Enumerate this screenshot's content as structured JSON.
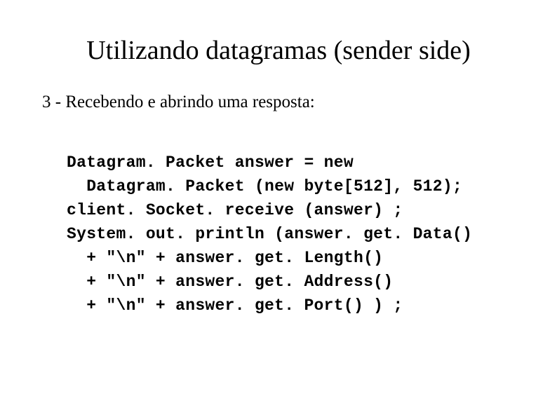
{
  "title": "Utilizando datagramas (sender side)",
  "subtitle": "3 - Recebendo e abrindo uma resposta:",
  "code": "Datagram. Packet answer = new\n  Datagram. Packet (new byte[512], 512);\nclient. Socket. receive (answer) ;\nSystem. out. println (answer. get. Data()\n  + \"\\n\" + answer. get. Length()\n  + \"\\n\" + answer. get. Address()\n  + \"\\n\" + answer. get. Port() ) ;"
}
